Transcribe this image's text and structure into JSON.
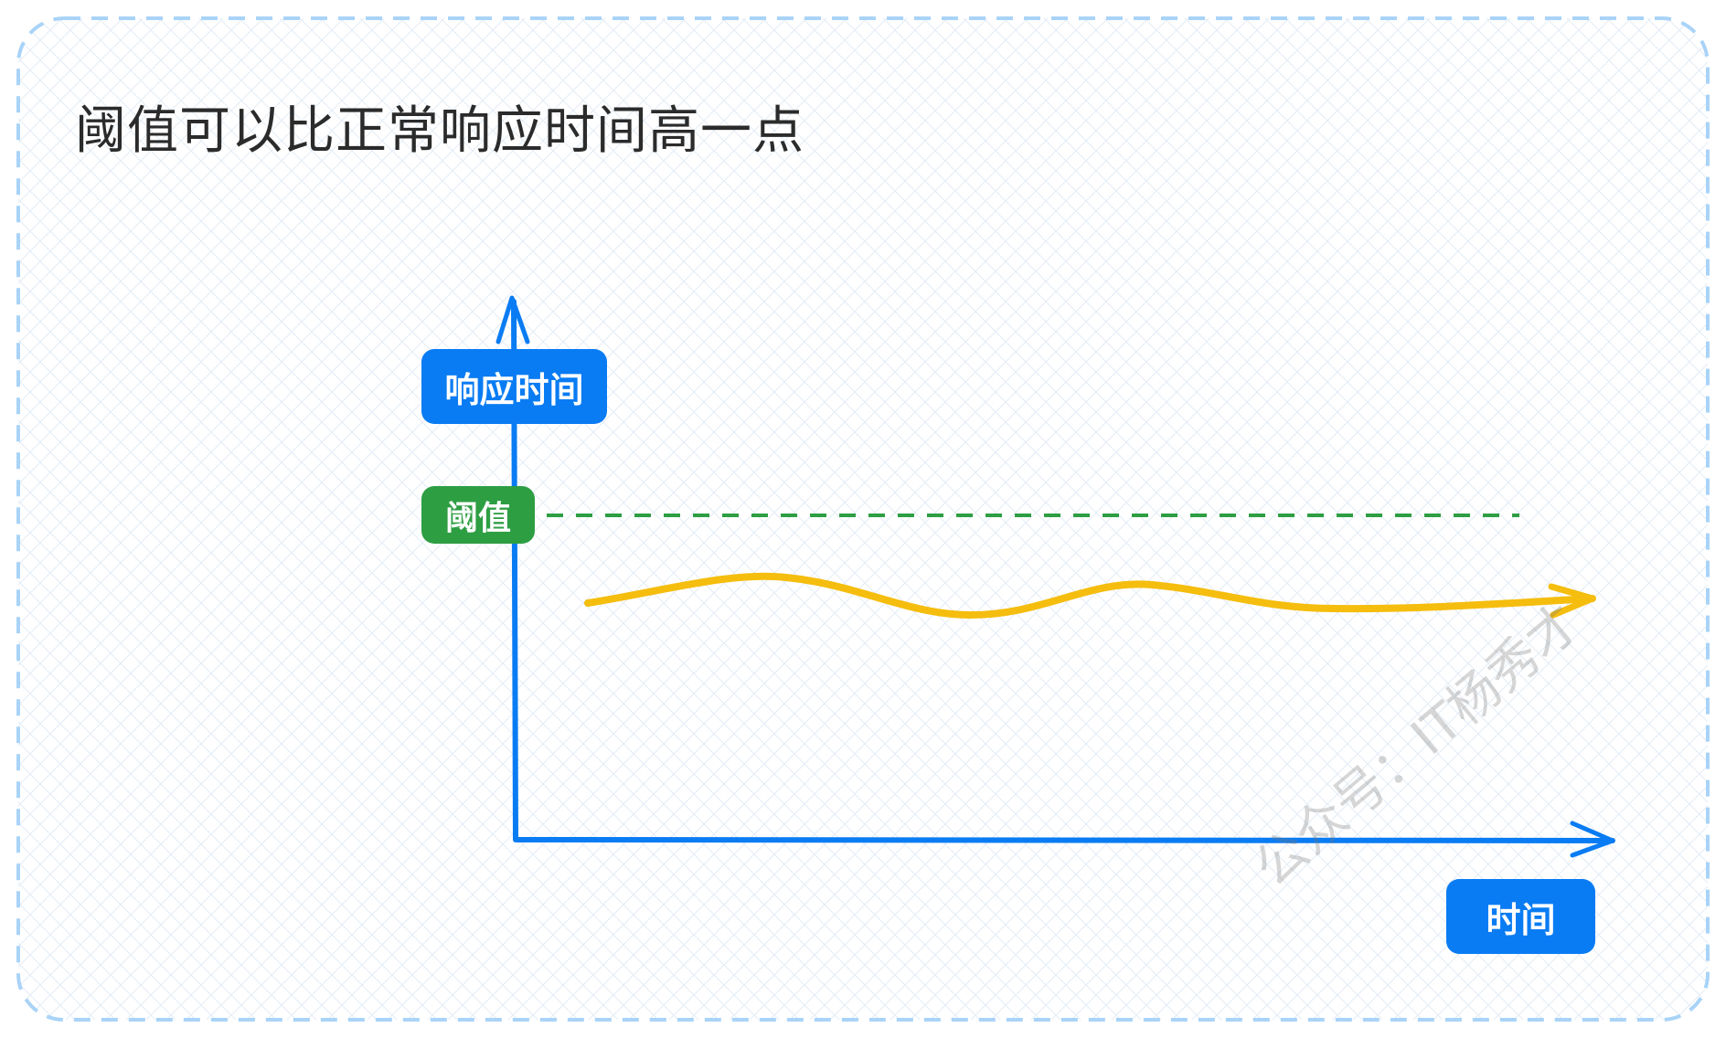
{
  "title": "阈值可以比正常响应时间高一点",
  "y_axis_label": "响应时间",
  "threshold_label": "阈值",
  "x_axis_label": "时间",
  "watermark": "公众号：IT杨秀才",
  "colors": {
    "axis": "#0a7cf3",
    "threshold": "#2e9e43",
    "curve": "#f5bd0e",
    "frame": "#a9d3f7",
    "grid": "#e6eef7"
  }
}
